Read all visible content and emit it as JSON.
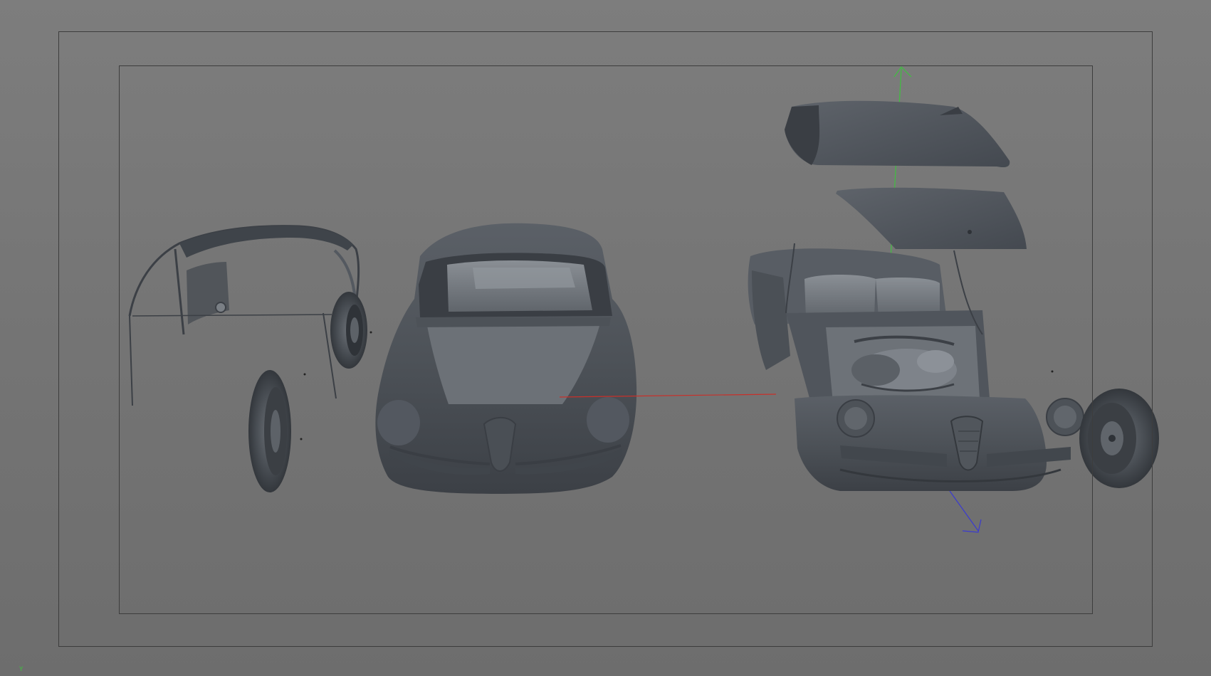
{
  "viewport": {
    "axis_indicator_label": "Y",
    "colors": {
      "background": "#767676",
      "frame": "#3d3d3d",
      "model_dark": "#3e4349",
      "model_mid": "#5a5f66",
      "model_light": "#7c8188",
      "axis_x": "#c8302a",
      "axis_y": "#3fbf3f",
      "axis_z": "#3a3ad0"
    }
  },
  "scene": {
    "objects": [
      "roof-shell-model",
      "front-wheel-left-model",
      "rear-wheel-left-model",
      "car-body-shell-model",
      "trunk-lid-model",
      "hood-panel-model",
      "car-chassis-engine-model",
      "front-wheel-right-model"
    ]
  }
}
